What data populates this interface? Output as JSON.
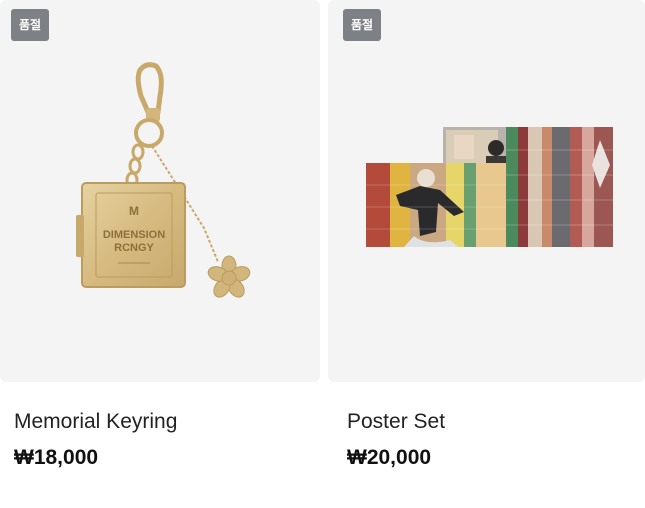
{
  "products": [
    {
      "badge": "품절",
      "name": "Memorial Keyring",
      "price": "₩18,000",
      "image_icon": "keyring-image",
      "image_text_line1": "DIMENSION",
      "image_text_line2": "RCNGY"
    },
    {
      "badge": "품절",
      "name": "Poster Set",
      "price": "₩20,000",
      "image_icon": "poster-set-image"
    }
  ],
  "colors": {
    "badge_bg": "#7d8186",
    "card_bg": "#f4f4f4",
    "gold": "#d8bd83"
  }
}
